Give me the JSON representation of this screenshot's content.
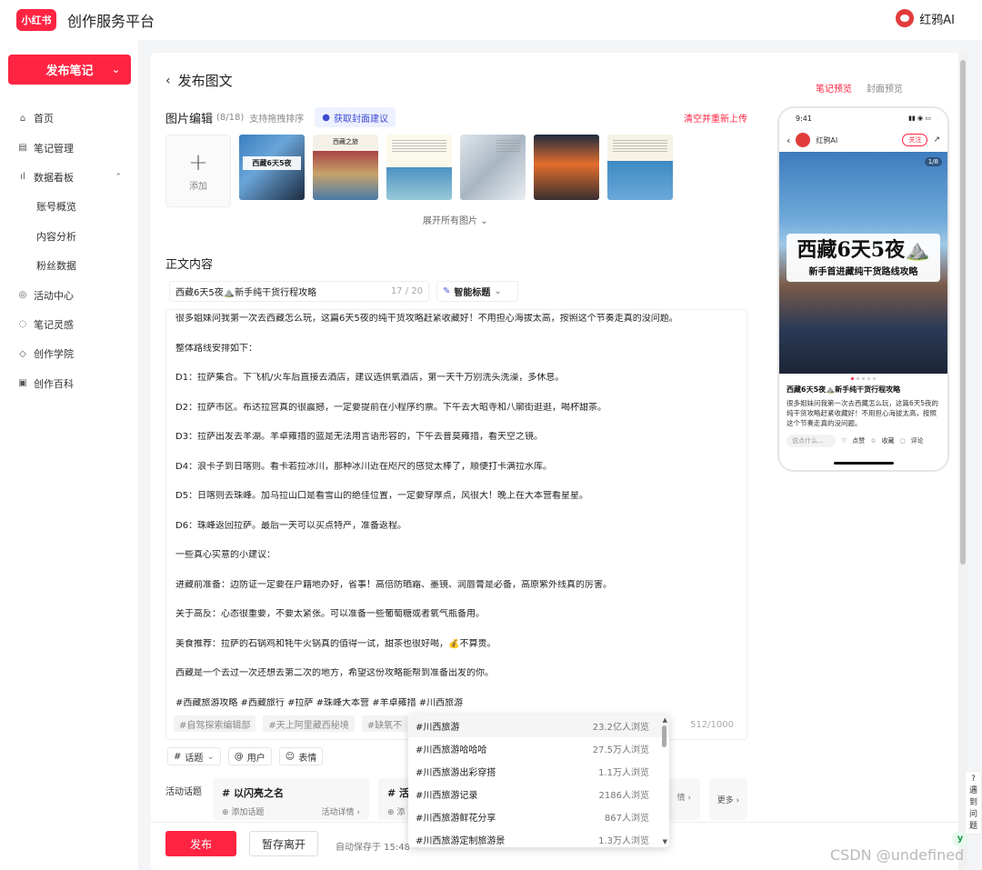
{
  "header": {
    "logo_text": "小红书",
    "platform_title": "创作服务平台",
    "user_name": "红鸦AI"
  },
  "sidebar": {
    "publish_button": "发布笔记",
    "items": [
      {
        "icon": "home-icon",
        "glyph": "⌂",
        "label": "首页"
      },
      {
        "icon": "note-manage-icon",
        "glyph": "▤",
        "label": "笔记管理"
      },
      {
        "icon": "dashboard-icon",
        "glyph": "ıl",
        "label": "数据看板"
      },
      {
        "label": "账号概览"
      },
      {
        "label": "内容分析"
      },
      {
        "label": "粉丝数据"
      },
      {
        "icon": "activity-icon",
        "glyph": "◎",
        "label": "活动中心"
      },
      {
        "icon": "inspiration-icon",
        "glyph": "◌",
        "label": "笔记灵感"
      },
      {
        "icon": "academy-icon",
        "glyph": "◇",
        "label": "创作学院"
      },
      {
        "icon": "wiki-icon",
        "glyph": "▣",
        "label": "创作百科"
      }
    ]
  },
  "editor_page": {
    "page_title": "发布图文",
    "image_section_title": "图片编辑",
    "image_count": "(8/18)",
    "image_sort_hint": "支持拖拽排序",
    "cover_suggest_button": "获取封面建议",
    "clear_reupload": "清空并重新上传",
    "add_label": "添加",
    "thumb_cover_caption": "西藏6天5夜",
    "thumb_poster_caption": "西藏之旅",
    "expand_all": "展开所有图片",
    "body_section_title": "正文内容",
    "title_value": "西藏6天5夜⛰️新手纯干货行程攻略",
    "title_counter": "17 / 20",
    "smart_title_button": "智能标题",
    "body_paragraphs": [
      "很多姐妹问我第一次去西藏怎么玩，这篇6天5夜的纯干货攻略赶紧收藏好！不用担心海拔太高，按照这个节奏走真的没问题。",
      "整体路线安排如下：",
      "D1：拉萨集合。下飞机/火车后直接去酒店，建议选供氧酒店，第一天千万别洗头洗澡，多休息。",
      "D2：拉萨市区。布达拉宫真的很震撼，一定要提前在小程序约票。下午去大昭寺和八廓街逛逛，喝杯甜茶。",
      "D3：拉萨出发去羊湖。羊卓雍措的蓝是无法用言语形容的，下午去普莫雍措，看天空之镜。",
      "D4：浪卡子到日喀则。看卡若拉冰川，那种冰川近在咫尺的感觉太棒了，顺便打卡满拉水库。",
      "D5：日喀则去珠峰。加乌拉山口是看雪山的绝佳位置，一定要穿厚点，风很大！晚上在大本营看星星。",
      "D6：珠峰返回拉萨。最后一天可以买点特产，准备返程。",
      "一些真心实意的小建议：",
      "进藏前准备：边防证一定要在户籍地办好，省事！高倍防晒霜、墨镜、润唇膏是必备，高原紫外线真的厉害。",
      "关于高反：心态很重要，不要太紧张。可以准备一些葡萄糖或者氧气瓶备用。",
      "美食推荐：拉萨的石锅鸡和牦牛火锅真的值得一试，甜茶也很好喝，💰不算贵。",
      "西藏是一个去过一次还想去第二次的地方，希望这份攻略能帮到准备出发的你。",
      "#西藏旅游攻略 #西藏旅行 #拉萨 #珠峰大本营 #羊卓雍措 #川西旅游"
    ],
    "suggested_tags": [
      "#自驾探索编辑部",
      "#天上阿里藏西秘境",
      "#缺氧不"
    ],
    "body_counter": "512/1000",
    "tools": [
      {
        "icon": "hash-icon",
        "glyph": "#",
        "label": "话题",
        "caret": "⌄"
      },
      {
        "icon": "at-icon",
        "glyph": "@",
        "label": "用户"
      },
      {
        "icon": "emoji-icon",
        "glyph": "☺",
        "label": "表情"
      }
    ],
    "activity_label": "活动话题",
    "activity_cards": [
      {
        "name": "# 以闪亮之名",
        "add": "⊕ 添加话题",
        "detail": "活动详情 ›"
      },
      {
        "name": "# 活",
        "add": "⊕ 添",
        "detail": ""
      },
      {
        "name": "",
        "add": "",
        "detail": "情 ›"
      }
    ],
    "more_label": "更多 ›",
    "publish_button": "发布",
    "draft_button": "暂存离开",
    "autosave": "自动保存于 15:48"
  },
  "topic_dropdown": [
    {
      "tag": "#川西旅游",
      "views": "23.2亿人浏览"
    },
    {
      "tag": "#川西旅游哈哈哈",
      "views": "27.5万人浏览"
    },
    {
      "tag": "#川西旅游出彩穿搭",
      "views": "1.1万人浏览"
    },
    {
      "tag": "#川西旅游记录",
      "views": "2186人浏览"
    },
    {
      "tag": "#川西旅游鲜花分享",
      "views": "867人浏览"
    },
    {
      "tag": "#川西旅游定制旅游景",
      "views": "1.3万人浏览"
    }
  ],
  "preview": {
    "tab_note": "笔记预览",
    "tab_cover": "封面预览",
    "time": "9:41",
    "signal": "▮▮ ◉ ▭",
    "author": "红鸦AI",
    "follow": "关注",
    "page_indicator": "1/8",
    "cover_title": "西藏6天5夜⛰️",
    "cover_subtitle": "新手首进藏纯干货路线攻略",
    "note_title": "西藏6天5夜⛰️新手纯干货行程攻略",
    "note_body": "很多姐妹问我第一次去西藏怎么玩，这篇6天5夜的纯干货攻略赶紧收藏好！不用担心海拔太高，按照这个节奏走真的没问题。",
    "comment_placeholder": "说点什么...",
    "like": "点赞",
    "collect": "收藏",
    "comment": "评论"
  },
  "floating": {
    "help": "遇到问题",
    "logo": "y"
  },
  "watermark": "CSDN @undefined",
  "colors": {
    "brand": "#ff2442",
    "accent_blue": "#3e4bd1"
  }
}
